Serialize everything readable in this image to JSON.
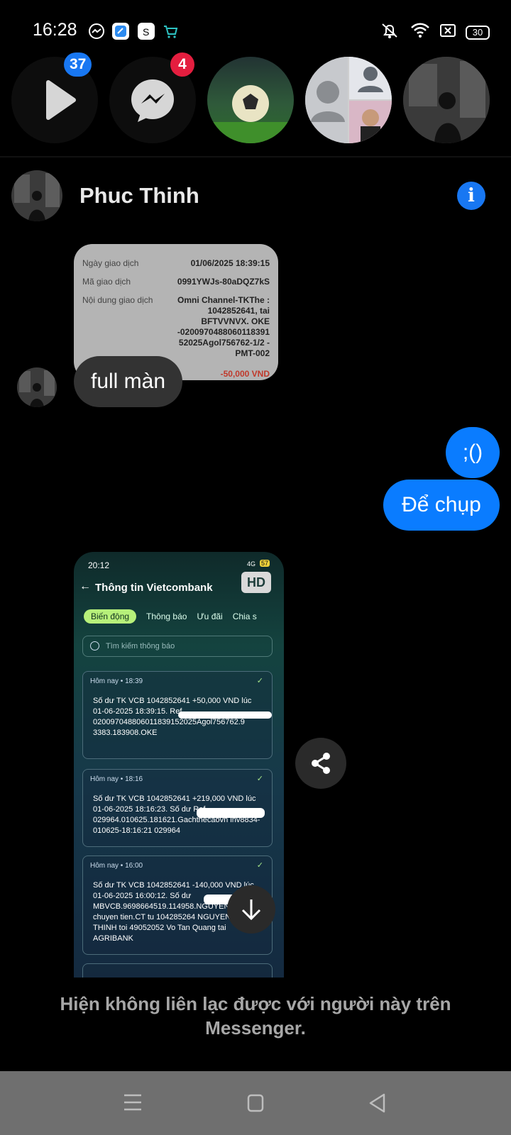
{
  "status_bar": {
    "time": "16:28",
    "battery": "30",
    "app_icons": [
      "messenger-icon",
      "blue-app-icon",
      "shopee-icon",
      "cart-icon"
    ],
    "right_icons": [
      "mute-icon",
      "wifi-icon",
      "sim-icon",
      "battery-icon"
    ]
  },
  "chat_heads": [
    {
      "name": "video-head",
      "badge": "37",
      "badge_color": "#1877f2"
    },
    {
      "name": "messenger-head",
      "badge": "4",
      "badge_color": "#e41e3f"
    },
    {
      "name": "football-head"
    },
    {
      "name": "group-head"
    },
    {
      "name": "person-head"
    }
  ],
  "conversation": {
    "name": "Phuc Thinh",
    "receipt": {
      "rows": [
        {
          "label": "Ngày giao dịch",
          "value": "01/06/2025 18:39:15"
        },
        {
          "label": "Mã giao dịch",
          "value": "0991YWJs-80aDQZ7kS"
        },
        {
          "label": "Nội dung giao dịch",
          "value": "Omni Channel-TKThe : 1042852641, tai BFTVVNVX. OKE -0200970488060118391 52025Agol756762-1/2 -PMT-002"
        }
      ],
      "amount": "-50,000 VND"
    },
    "incoming_message": "full màn",
    "outgoing_messages": [
      ";()",
      "Để chụp"
    ],
    "shared_screenshot": {
      "time": "20:12",
      "signal": "4G",
      "battery": "57",
      "title": "Thông tin Vietcombank",
      "hd_badge": "HD",
      "tabs": [
        "Biến động",
        "Thông báo",
        "Ưu đãi",
        "Chia s"
      ],
      "search_placeholder": "Tìm kiếm thông báo",
      "cards": [
        {
          "header": "Hôm nay • 18:39",
          "body": "Số dư TK VCB 1042852641 +50,000 VND lúc 01-06-2025 18:39:15. Ref 020097048806011839152025Agol756762.9 3383.183908.OKE"
        },
        {
          "header": "Hôm nay • 18:16",
          "body": "Số dư TK VCB 1042852641 +219,000 VND lúc 01-06-2025 18:16:23. Số dư Ref 029964.010625.181621.Gachthecaovn inv8834-010625-18:16:21 029964"
        },
        {
          "header": "Hôm nay • 16:00",
          "body": "Số dư TK VCB 1042852641 -140,000 VND lúc 01-06-2025 16:00:12. Số dư MBVCB.9698664519.114958.NGUYEN THINH chuyen tien.CT tu 104285264 NGUYEN PHUC THINH toi 49052052 Vo Tan Quang tai AGRIBANK"
        }
      ]
    },
    "notice": "Hiện không liên lạc được với người này trên Messenger."
  },
  "nav_bar": {
    "icons": [
      "menu-icon",
      "home-icon",
      "back-icon"
    ]
  }
}
